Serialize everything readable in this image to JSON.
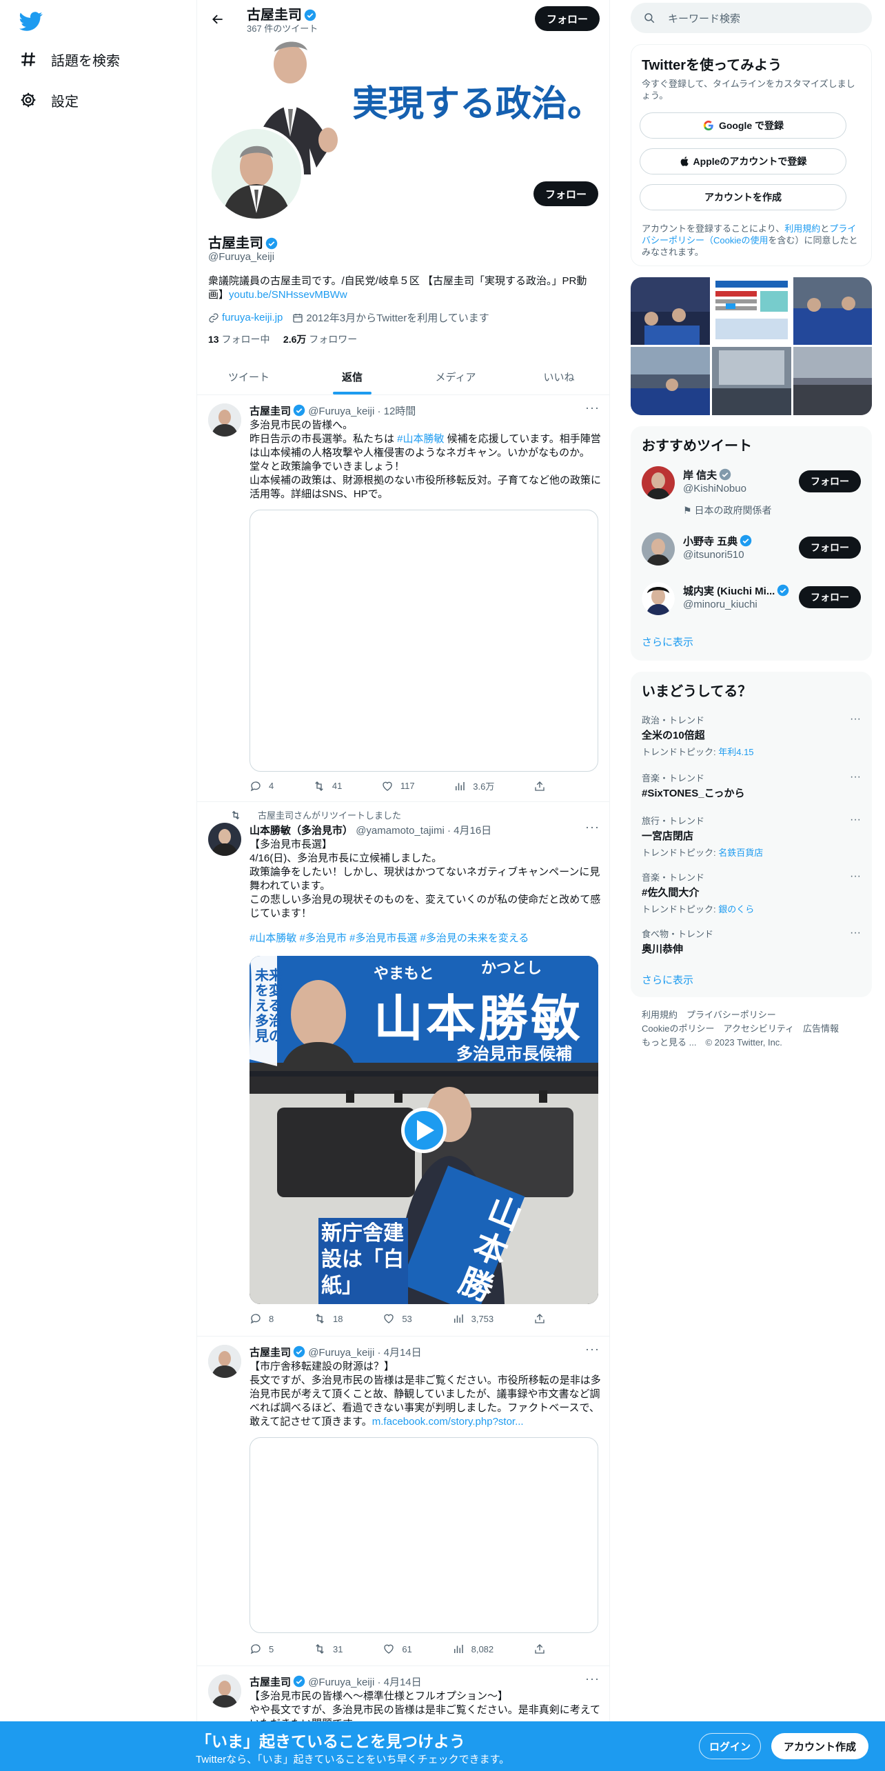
{
  "nav": {
    "explore_label": "話題を検索",
    "settings_label": "設定"
  },
  "header": {
    "name": "古屋圭司",
    "tweet_count": "367 件のツイート",
    "follow_label": "フォロー"
  },
  "banner": {
    "slogan": "実現する政治。"
  },
  "profile": {
    "name": "古屋圭司",
    "handle": "@Furuya_keiji",
    "bio": "衆議院議員の古屋圭司です。/自民党/岐阜５区 【古屋圭司「実現する政治。」PR動画】",
    "bio_link": "youtu.be/SNHssevMBWw",
    "website": "furuya-keiji.jp",
    "joined": "2012年3月からTwitterを利用しています",
    "following_count": "13",
    "following_label": "フォロー中",
    "followers_count": "2.6万",
    "followers_label": "フォロワー",
    "follow_label": "フォロー"
  },
  "tabs": [
    {
      "label": "ツイート"
    },
    {
      "label": "返信"
    },
    {
      "label": "メディア"
    },
    {
      "label": "いいね"
    }
  ],
  "tweets": [
    {
      "name": "古屋圭司",
      "handle": "@Furuya_keiji",
      "time": "12時間",
      "line1": "多治見市民の皆様へ。",
      "line2a": "昨日告示の市長選挙。私たちは ",
      "hashtag": "#山本勝敏",
      "line2b": " 候補を応援しています。相手陣営は山本候補の人格攻撃や人権侵害のようなネガキャン。いかがなものか。堂々と政策論争でいきましょう！",
      "line3": "山本候補の政策は、財源根拠のない市役所移転反対。子育てなど他の政策に活用等。詳細はSNS、HPで。",
      "replies": "4",
      "retweets": "41",
      "likes": "117",
      "views": "3.6万"
    },
    {
      "retweeted_by": "古屋圭司さんがリツイートしました",
      "name": "山本勝敏（多治見市）",
      "handle": "@yamamoto_tajimi",
      "time": "4月16日",
      "text1": "【多治見市長選】",
      "text2": "4/16(日)、多治見市長に立候補しました。",
      "text3": "政策論争をしたい！しかし、現状はかつてないネガティブキャンペーンに見舞われています。",
      "text4": "この悲しい多治見の現状そのものを、変えていくのが私の使命だと改めて感じています！",
      "hashtags": "#山本勝敏 #多治見市 #多治見市長選 #多治見の未来を変える",
      "poster_name": "山本勝敏",
      "poster_reading_1": "やまもと",
      "poster_reading_2": "かつとし",
      "poster_sub": "多治見市長候補",
      "poster_side": "未来を変える多治見の",
      "poster_sash": "山本勝",
      "poster_sign": "新庁舎建設は「白紙」",
      "replies": "8",
      "retweets": "18",
      "likes": "53",
      "views": "3,753"
    },
    {
      "name": "古屋圭司",
      "handle": "@Furuya_keiji",
      "time": "4月14日",
      "text1": "【市庁舎移転建設の財源は？】",
      "text2": "長文ですが、多治見市民の皆様は是非ご覧ください。市役所移転の是非は多治見市民が考えて頂くこと故、静観していましたが、議事録や市文書など調べれば調べるほど、看過できない事実が判明しました。ファクトベースで、敢えて記させて頂きます。",
      "link": "m.facebook.com/story.php?stor...",
      "replies": "5",
      "retweets": "31",
      "likes": "61",
      "views": "8,082"
    },
    {
      "name": "古屋圭司",
      "handle": "@Furuya_keiji",
      "time": "4月14日",
      "text1": "【多治見市民の皆様へ～標準仕様とフルオプション～】",
      "text2": "やや長文ですが、多治見市民の皆様は是非ご覧ください。是非真剣に考えていただきたい問題です。"
    }
  ],
  "right": {
    "search_placeholder": "キーワード検索",
    "join": {
      "title": "Twitterを使ってみよう",
      "subtitle": "今すぐ登録して、タイムラインをカスタマイズしましょう。",
      "google": "Google で登録",
      "apple": "Appleのアカウントで登録",
      "create": "アカウントを作成",
      "terms_a": "アカウントを登録することにより、",
      "terms_link1": "利用規約",
      "terms_b": "と",
      "terms_link2": "プライバシーポリシー（Cookieの使用",
      "terms_c": "を含む）に同意したとみなされます。"
    },
    "suggest": {
      "title": "おすすめツイート",
      "users": [
        {
          "name": "岸 信夫",
          "handle": "@KishiNobuo",
          "note": "日本の政府関係者",
          "follow": "フォロー"
        },
        {
          "name": "小野寺 五典",
          "handle": "@itsunori510",
          "follow": "フォロー"
        },
        {
          "name": "城内実 (Kiuchi Mi...",
          "handle": "@minoru_kiuchi",
          "follow": "フォロー"
        }
      ],
      "more": "さらに表示"
    },
    "trends": {
      "title": "いまどうしてる？",
      "items": [
        {
          "cat": "政治・トレンド",
          "title": "全米の10倍超",
          "sub_label": "トレンドトピック: ",
          "sub_link": "年利4.15"
        },
        {
          "cat": "音楽・トレンド",
          "title": "#SixTONES_こっから"
        },
        {
          "cat": "旅行・トレンド",
          "title": "一宮店閉店",
          "sub_label": "トレンドトピック: ",
          "sub_link": "名鉄百貨店"
        },
        {
          "cat": "音楽・トレンド",
          "title": "#佐久間大介",
          "sub_label": "トレンドトピック: ",
          "sub_link": "銀のくら"
        },
        {
          "cat": "食べ物・トレンド",
          "title": "奥川恭伸"
        }
      ],
      "more": "さらに表示"
    },
    "footer": {
      "l1": "利用規約　プライバシーポリシー",
      "l2": "Cookieのポリシー　アクセシビリティ　広告情報",
      "l3": "もっと見る ...　© 2023 Twitter, Inc."
    }
  },
  "bottom": {
    "title": "「いま」起きていることを見つけよう",
    "subtitle": "Twitterなら、「いま」起きていることをいち早くチェックできます。",
    "login": "ログイン",
    "signup": "アカウント作成"
  },
  "colors": {
    "accent": "#1d9bf0",
    "dark": "#0f1419",
    "muted": "#536471"
  }
}
